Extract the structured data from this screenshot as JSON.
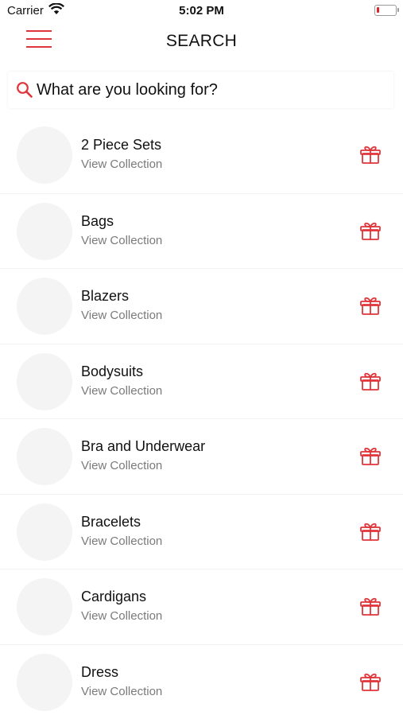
{
  "status_bar": {
    "carrier": "Carrier",
    "time": "5:02 PM"
  },
  "header": {
    "title": "SEARCH"
  },
  "search": {
    "placeholder": "What are you looking for?"
  },
  "collections": [
    {
      "name": "2 Piece Sets",
      "subtitle": "View Collection"
    },
    {
      "name": "Bags",
      "subtitle": "View Collection"
    },
    {
      "name": "Blazers",
      "subtitle": "View Collection"
    },
    {
      "name": "Bodysuits",
      "subtitle": "View Collection"
    },
    {
      "name": "Bra and Underwear",
      "subtitle": "View Collection"
    },
    {
      "name": "Bracelets",
      "subtitle": "View Collection"
    },
    {
      "name": "Cardigans",
      "subtitle": "View Collection"
    },
    {
      "name": "Dress",
      "subtitle": "View Collection"
    }
  ],
  "colors": {
    "accent": "#e0353a",
    "text": "#111111",
    "subtext": "#7a7a7a"
  },
  "icons": {
    "menu": "hamburger-menu-icon",
    "search": "search-icon",
    "row_action": "gift-box-icon"
  }
}
